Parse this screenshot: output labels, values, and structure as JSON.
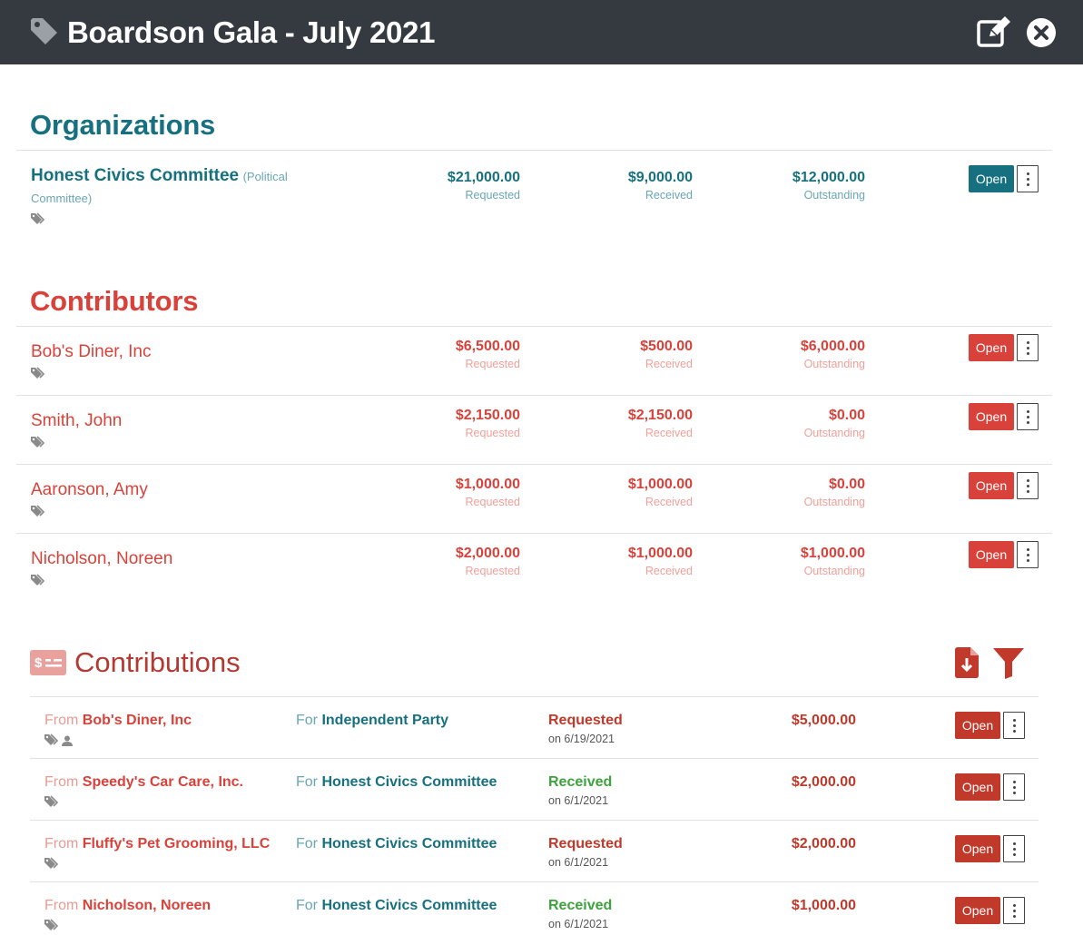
{
  "header": {
    "title": "Boardson Gala - July 2021"
  },
  "organizations": {
    "title": "Organizations",
    "rows": [
      {
        "name": "Honest Civics Committee",
        "type": "(Political Committee)",
        "requested": "$21,000.00",
        "received": "$9,000.00",
        "outstanding": "$12,000.00"
      }
    ]
  },
  "contributors": {
    "title": "Contributors",
    "rows": [
      {
        "name": "Bob's Diner, Inc",
        "requested": "$6,500.00",
        "received": "$500.00",
        "outstanding": "$6,000.00"
      },
      {
        "name": "Smith, John",
        "requested": "$2,150.00",
        "received": "$2,150.00",
        "outstanding": "$0.00"
      },
      {
        "name": "Aaronson, Amy",
        "requested": "$1,000.00",
        "received": "$1,000.00",
        "outstanding": "$0.00"
      },
      {
        "name": "Nicholson, Noreen",
        "requested": "$2,000.00",
        "received": "$1,000.00",
        "outstanding": "$1,000.00"
      }
    ]
  },
  "labels": {
    "requested": "Requested",
    "received": "Received",
    "outstanding": "Outstanding",
    "open": "Open",
    "from": "From",
    "for": "For"
  },
  "contributions": {
    "title": "Contributions",
    "rows": [
      {
        "from": "Bob's Diner, Inc",
        "for": "Independent Party",
        "status": "Requested",
        "date": "on 6/19/2021",
        "amount": "$5,000.00"
      },
      {
        "from": "Speedy's Car Care, Inc.",
        "for": "Honest Civics Committee",
        "status": "Received",
        "date": "on 6/1/2021",
        "amount": "$2,000.00"
      },
      {
        "from": "Fluffy's Pet Grooming, LLC",
        "for": "Honest Civics Committee",
        "status": "Requested",
        "date": "on 6/1/2021",
        "amount": "$2,000.00"
      },
      {
        "from": "Nicholson, Noreen",
        "for": "Honest Civics Committee",
        "status": "Received",
        "date": "on 6/1/2021",
        "amount": "$1,000.00"
      }
    ]
  },
  "colors": {
    "header_bg": "#343a40",
    "teal": "#16707f",
    "red": "#d9423a",
    "received_green": "#3ea33e"
  }
}
